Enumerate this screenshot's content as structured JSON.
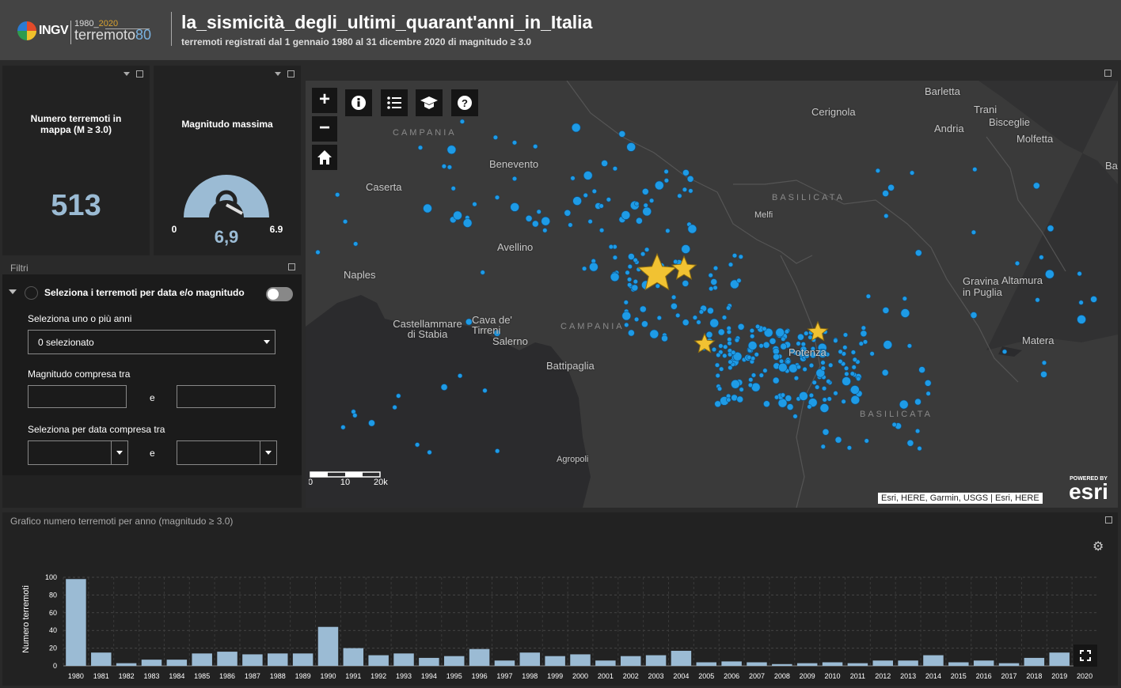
{
  "header": {
    "logo_ingv": "INGV",
    "logo_year_start": "1980_",
    "logo_year_end": "2020",
    "logo_word": "terremoto",
    "logo_word_num": "80",
    "title": "la_sismicità_degli_ultimi_quarant'anni_in_Italia",
    "subtitle": "terremoti registrati dal 1 gennaio 1980 al 31 dicembre 2020 di magnitudo ≥ 3.0"
  },
  "indicator_count": {
    "title": "Numero terremoti in mappa (M ≥ 3.0)",
    "value": "513"
  },
  "indicator_gauge": {
    "title": "Magnitudo massima",
    "value": "6,9",
    "min": "0",
    "max": "6.9",
    "fill_fraction": 1.0
  },
  "filters": {
    "panel_title": "Filtri",
    "toggle_label": "Seleziona i terremoti per data e/o magnitudo",
    "years_label": "Seleziona uno o più anni",
    "years_value": "0 selezionato",
    "mag_label": "Magnitudo compresa tra",
    "and1": "e",
    "date_label": "Seleziona per data compresa tra",
    "and2": "e"
  },
  "map": {
    "labels": [
      "Barletta",
      "Cerignola",
      "Trani",
      "Andria",
      "Bisceglie",
      "Molfetta",
      "Ba",
      "Benevento",
      "Caserta",
      "Melfi",
      "Avellino",
      "Naples",
      "Gravina in Puglia",
      "Altamura",
      "Castellammare di Stabia",
      "Cava de' Tirreni",
      "Salerno",
      "Potenza",
      "Matera",
      "Battipaglia",
      "Agropoli"
    ],
    "regions": [
      "CAMPANIA",
      "BASILICATA",
      "CAMPANIA",
      "BASILICATA"
    ],
    "scale": {
      "t0": "0",
      "t1": "10",
      "t2": "20km"
    },
    "attribution": "Esri, HERE, Garmin, USGS | Esri, HERE",
    "powered_by": "POWERED BY",
    "esri": "esri",
    "zoom_in": "+",
    "zoom_out": "−"
  },
  "chart_title": "Grafico numero terremoti per anno (magnitudo ≥ 3.0)",
  "chart_data": {
    "type": "bar",
    "ylabel": "Numero terremoti",
    "xlabel": "",
    "ylim": [
      0,
      100
    ],
    "yticks": [
      0,
      20,
      40,
      60,
      80,
      100
    ],
    "categories": [
      "1980",
      "1981",
      "1982",
      "1983",
      "1984",
      "1985",
      "1986",
      "1987",
      "1988",
      "1989",
      "1990",
      "1991",
      "1992",
      "1993",
      "1994",
      "1995",
      "1996",
      "1997",
      "1998",
      "1999",
      "2000",
      "2001",
      "2002",
      "2003",
      "2004",
      "2005",
      "2006",
      "2007",
      "2008",
      "2009",
      "2010",
      "2011",
      "2012",
      "2013",
      "2014",
      "2015",
      "2016",
      "2017",
      "2018",
      "2019",
      "2020"
    ],
    "values": [
      98,
      15,
      3,
      7,
      7,
      14,
      16,
      13,
      14,
      14,
      44,
      20,
      12,
      14,
      9,
      11,
      19,
      6,
      15,
      11,
      13,
      6,
      11,
      12,
      17,
      4,
      5,
      4,
      2,
      3,
      4,
      3,
      6,
      6,
      12,
      4,
      6,
      3,
      9,
      15,
      14
    ],
    "bar_color": "#9bbbd4"
  },
  "colors": {
    "accent": "#9bbbd4",
    "quake": "#1e9be6",
    "star": "#f1c232"
  }
}
